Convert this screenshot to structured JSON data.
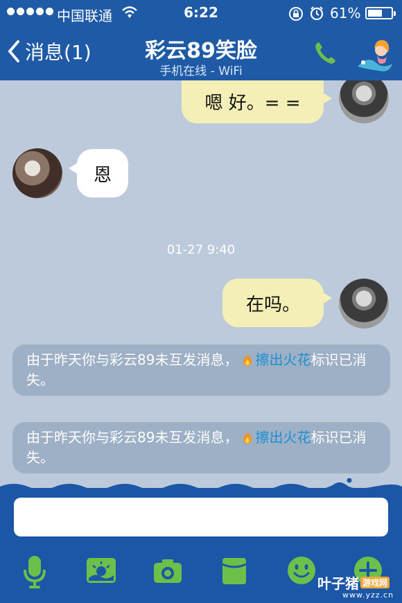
{
  "status_bar": {
    "carrier": "中国联通",
    "time": "6:22",
    "battery_percent": "61%",
    "battery_level": 0.61
  },
  "nav": {
    "back_label": "消息(1)",
    "title": "彩云89笑脸",
    "subtitle": "手机在线 - WiFi"
  },
  "messages": [
    {
      "side": "out",
      "text": "嗯 好。= ="
    },
    {
      "side": "in",
      "text": "恩"
    },
    {
      "side": "out",
      "text": "在吗。"
    }
  ],
  "timestamp": "01-27 9:40",
  "system_notices": [
    {
      "before": "由于昨天你与彩云89未互发消息，",
      "link": "擦出火花",
      "after": "标识已消失。"
    },
    {
      "before": "由于昨天你与彩云89未互发消息，",
      "link": "擦出火花",
      "after": "标识已消失。"
    }
  ],
  "input": {
    "value": ""
  },
  "toolbar": [
    "microphone-icon",
    "photo-icon",
    "camera-icon",
    "mailbox-icon",
    "emoji-icon",
    "plus-icon"
  ],
  "watermark": {
    "name": "叶子猪",
    "badge": "游戏网",
    "url": "www.yzz.cn"
  },
  "colors": {
    "bar_blue": "#1e5aa6",
    "chat_bg": "#bccadc",
    "outgoing_bubble": "#f4efb7",
    "incoming_bubble": "#ffffff",
    "notice_bg": "#9eb0c5",
    "link": "#1a8fd6",
    "icon_green": "#6cc04a"
  }
}
